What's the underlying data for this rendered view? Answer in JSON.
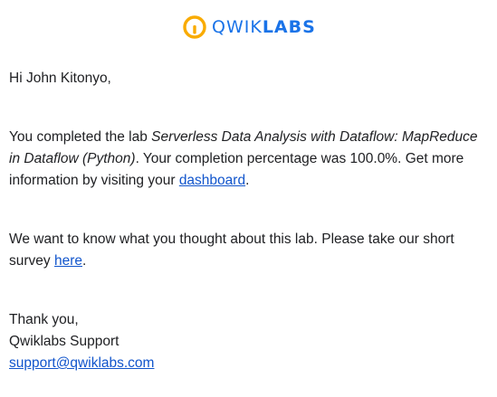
{
  "brand": {
    "name_part1": "QWIK",
    "name_part2": "LABS",
    "colors": {
      "logo_blue": "#1a73e8",
      "logo_yellow": "#f9ab00",
      "link": "#1155cc",
      "text": "#202124"
    },
    "icon": "qwiklabs-logo-icon"
  },
  "email": {
    "greeting": "Hi John Kitonyo,",
    "completed": {
      "prefix": "You completed the lab ",
      "lab_title": "Serverless Data Analysis with Dataflow: MapReduce in Dataflow (Python)",
      "middle": ". Your completion percentage was 100.0%. Get more information by visiting your ",
      "dashboard_link": "dashboard",
      "suffix": "."
    },
    "survey": {
      "text": "We want to know what you thought about this lab. Please take our short survey ",
      "link": "here",
      "suffix": "."
    },
    "signoff": {
      "thanks": "Thank you,",
      "team": "Qwiklabs Support",
      "email_link": "support@qwiklabs.com"
    }
  }
}
